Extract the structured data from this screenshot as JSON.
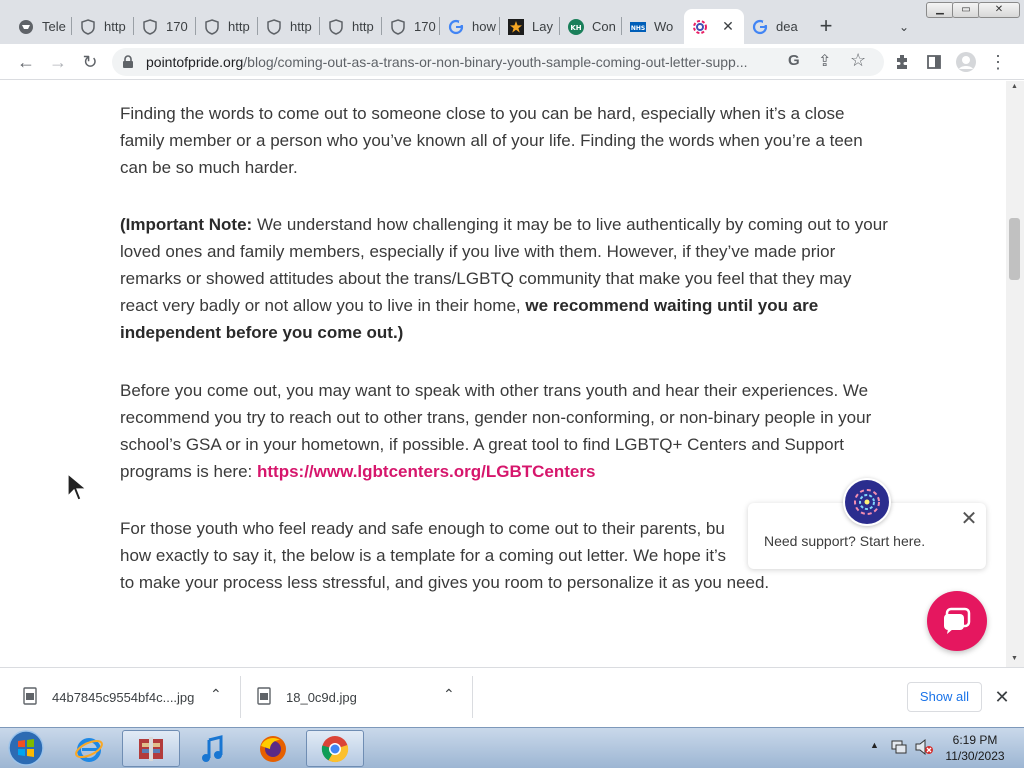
{
  "window": {
    "minimize_glyph": "▁",
    "maximize_glyph": "▭",
    "close_glyph": "✕"
  },
  "tabs": [
    {
      "label": "Tele",
      "icon": "globe-icon"
    },
    {
      "label": "http",
      "icon": "shield-icon"
    },
    {
      "label": "170",
      "icon": "shield-icon"
    },
    {
      "label": "http",
      "icon": "shield-icon"
    },
    {
      "label": "http",
      "icon": "shield-icon"
    },
    {
      "label": "http",
      "icon": "shield-icon"
    },
    {
      "label": "170",
      "icon": "shield-icon"
    },
    {
      "label": "how",
      "icon": "google-icon"
    },
    {
      "label": "Lay",
      "icon": "star-icon"
    },
    {
      "label": "Con",
      "icon": "kh-icon"
    },
    {
      "label": "Wo",
      "icon": "nhs-icon"
    },
    {
      "label": "",
      "icon": "pride-icon",
      "active": true
    },
    {
      "label": "dea",
      "icon": "google-icon"
    }
  ],
  "tab_strip": {
    "new_tab": "+",
    "tab_search": "⌄",
    "close_active_tab": "✕"
  },
  "toolbar": {
    "url_host": "pointofpride.org",
    "url_path": "/blog/coming-out-as-a-trans-or-non-binary-youth-sample-coming-out-letter-supp...",
    "google_glyph": "G",
    "back_glyph": "←",
    "forward_glyph": "→",
    "reload_glyph": "↻",
    "share_glyph": "⇪",
    "bookmark_glyph": "☆",
    "extensions_glyph": "✱",
    "menu_glyph": "⋮"
  },
  "article": {
    "p1": "Finding the words to come out to someone close to you can be hard, especially when it’s a close family member or a person who you’ve known all of your life. Finding the words when you’re a teen can be so much harder.",
    "p2_bold_start": "(Important Note:",
    "p2_mid": " We understand how challenging it may be to live authentically by coming out to your loved ones and family members, especially if you live with them. However, if they’ve made prior remarks or showed attitudes about the trans/LGBTQ community that make you feel that they may react very badly or not allow you to live in their home, ",
    "p2_bold_end": "we recommend waiting until you are independent before you come out.)",
    "p3": "Before you come out, you may want to speak with other trans youth and hear their experiences. We recommend you try to reach out to other trans, gender non-conforming, or non-binary people in your school’s GSA or in your hometown, if possible. A great tool to find LGBTQ+ Centers and Support programs is here: ",
    "p3_link": "https://www.lgbtcenters.org/LGBTCenters",
    "p4": "For those youth who feel ready and safe enough to come out to their parents, bu",
    "p4_line2": "how exactly to say it, the below is a template for a coming out letter. We hope it’s",
    "p4_line3": "to make your process less stressful, and gives you room to personalize it as you need."
  },
  "support_popup": {
    "text": "Need support? Start here.",
    "close_glyph": "✕"
  },
  "downloads": {
    "items": [
      {
        "name": "44b7845c9554bf4c....jpg"
      },
      {
        "name": "18_0c9d.jpg"
      }
    ],
    "chevron": "⌃",
    "show_all": "Show all",
    "close_glyph": "✕"
  },
  "taskbar": {
    "time": "6:19 PM",
    "date": "11/30/2023"
  },
  "colors": {
    "link": "#d6166c",
    "chat": "#e5175f",
    "avatar": "#2b2d8e"
  }
}
